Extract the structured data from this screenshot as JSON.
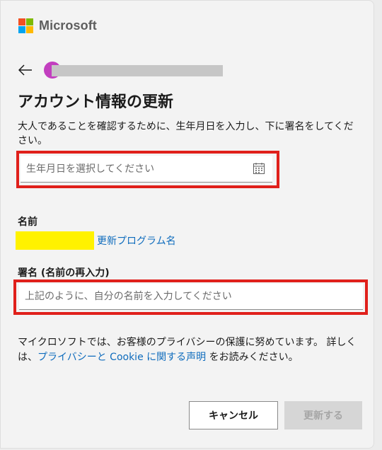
{
  "brand": {
    "name": "Microsoft",
    "colors": [
      "#f25022",
      "#7fba00",
      "#00a4ef",
      "#ffb900"
    ]
  },
  "header": {
    "back_icon": "arrow-left-icon"
  },
  "page": {
    "title": "アカウント情報の更新",
    "description": "大人であることを確認するために、生年月日を入力し、下に署名をしてください。"
  },
  "birthdate": {
    "placeholder": "生年月日を選択してください",
    "value": "",
    "icon": "calendar-icon"
  },
  "name_section": {
    "label": "名前",
    "value": "更新プログラム名"
  },
  "signature": {
    "label": "署名 (名前の再入力)",
    "placeholder": "上記のように、自分の名前を入力してください",
    "value": ""
  },
  "privacy": {
    "text_before": "マイクロソフトでは、お客様のプライバシーの保護に努めています。 詳しくは、",
    "link": "プライバシーと Cookie に関する声明",
    "text_after": " をお読みください。"
  },
  "buttons": {
    "cancel": "キャンセル",
    "update": "更新する"
  },
  "colors": {
    "accent": "#0f6cbd",
    "highlight_border": "#e0201b",
    "avatar": "#c23fbf",
    "name_redaction": "#fff200"
  }
}
